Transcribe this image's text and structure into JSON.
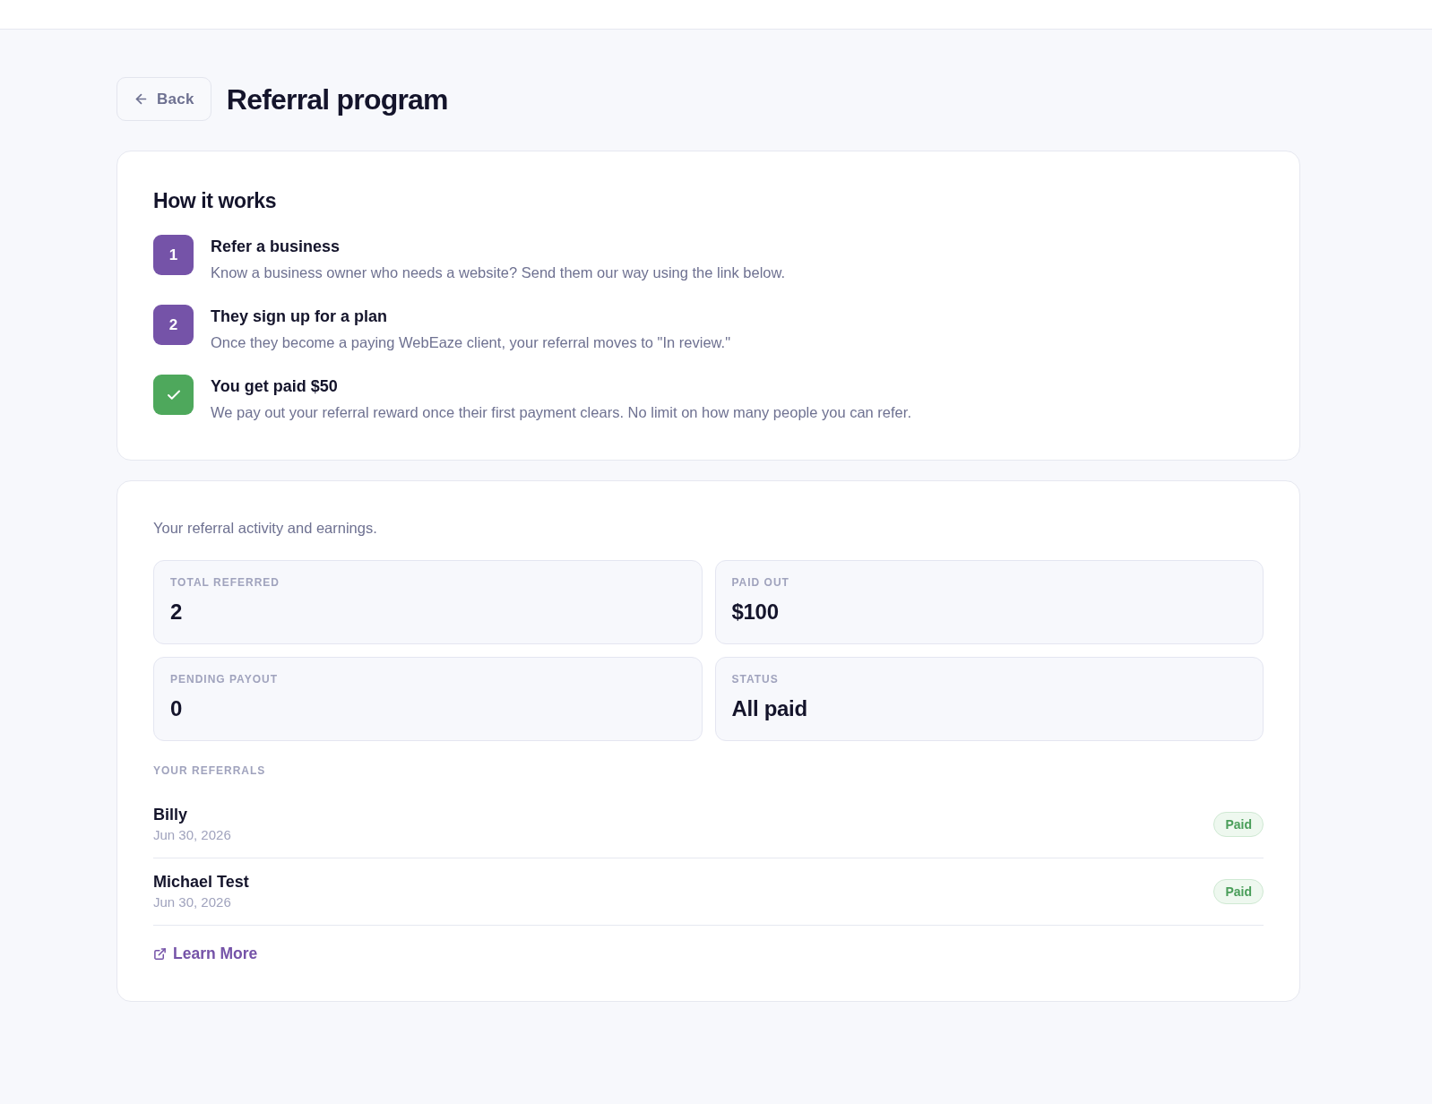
{
  "page": {
    "title": "Referral program",
    "back_button": {
      "label": "Back"
    }
  },
  "how_it_works": {
    "heading": "How it works",
    "steps": [
      {
        "kind": "number",
        "badge": "1",
        "color": "#7553a8",
        "title": "Refer a business",
        "description": "Know a business owner who needs a website? Send them our way using the link below."
      },
      {
        "kind": "number",
        "badge": "2",
        "color": "#7553a8",
        "title": "They sign up for a plan",
        "description": "Once they become a paying WebEaze client, your referral moves to \"In review.\""
      },
      {
        "kind": "check",
        "color": "#4ea85c",
        "title": "You get paid $50",
        "description": "We pay out your referral reward once their first payment clears. No limit on how many people you can refer."
      }
    ]
  },
  "activity": {
    "intro": "Your referral activity and earnings.",
    "stats": [
      {
        "label": "TOTAL REFERRED",
        "value": "2"
      },
      {
        "label": "PAID OUT",
        "value": "$100"
      },
      {
        "label": "PENDING PAYOUT",
        "value": "0"
      },
      {
        "label": "STATUS",
        "value": "All paid"
      }
    ],
    "referrals_heading": "YOUR REFERRALS",
    "referrals": [
      {
        "name": "Billy",
        "date": "Jun 30, 2026",
        "status": "Paid"
      },
      {
        "name": "Michael Test",
        "date": "Jun 30, 2026",
        "status": "Paid"
      }
    ],
    "learn_more": "Learn More"
  }
}
